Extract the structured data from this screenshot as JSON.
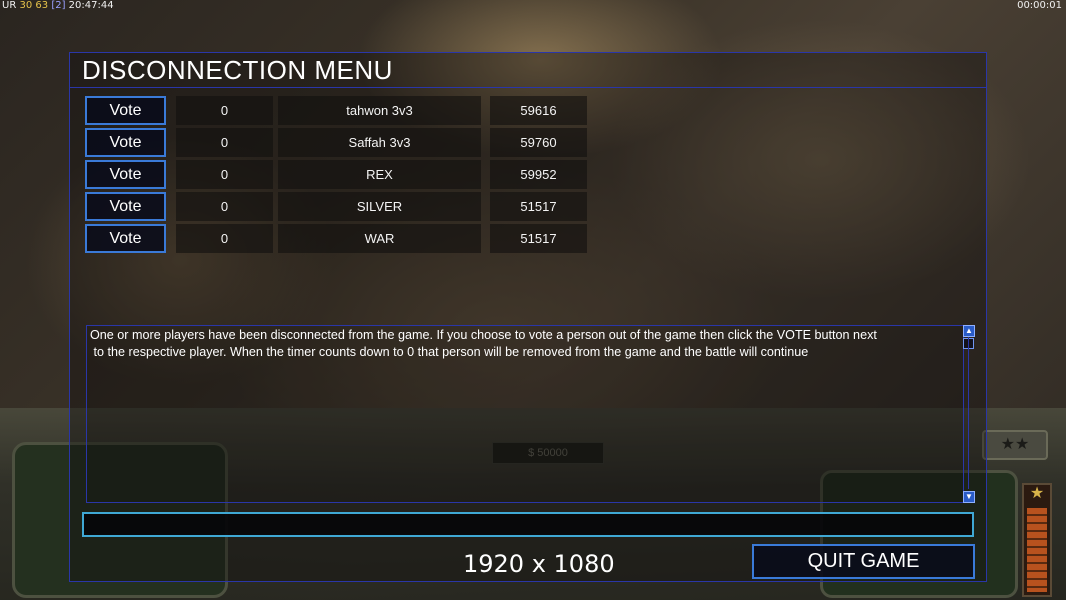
{
  "hud": {
    "ur_label": "UR",
    "value_a": "30",
    "value_b": "63",
    "value_c": "[2]",
    "clock": "20:47:44",
    "game_timer": "00:00:01"
  },
  "background": {
    "money": "$ 50000",
    "rank_icon": "star-rank-icon"
  },
  "dialog": {
    "title": "DISCONNECTION MENU",
    "vote_label": "Vote",
    "players": [
      {
        "votes": "0",
        "name": "tahwon 3v3",
        "ping": "59616"
      },
      {
        "votes": "0",
        "name": "Saffah 3v3",
        "ping": "59760"
      },
      {
        "votes": "0",
        "name": "REX",
        "ping": "59952"
      },
      {
        "votes": "0",
        "name": "SILVER",
        "ping": "51517"
      },
      {
        "votes": "0",
        "name": "WAR",
        "ping": "51517"
      }
    ],
    "message_line1": "One or more players have been disconnected from the game. If you choose to vote a person out of the game then click the VOTE button next",
    "message_line2": " to the respective player. When the timer counts down to 0 that person will be removed from the game and the battle will continue",
    "chat_value": "",
    "quit_label": "QUIT GAME"
  },
  "overlay": {
    "resolution": "1920 x 1080"
  },
  "colors": {
    "frame": "#2a36a8",
    "button_border": "#3a7ad8",
    "input_border": "#3fa8d4"
  }
}
